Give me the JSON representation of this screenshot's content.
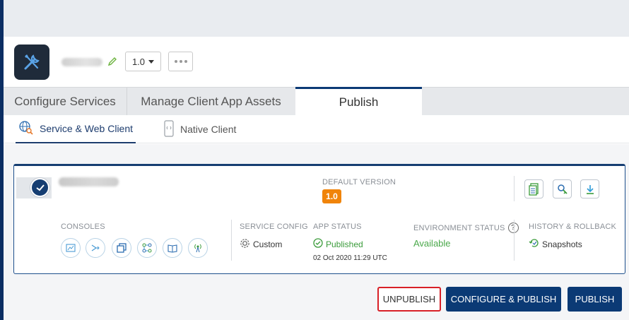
{
  "app": {
    "version": "1.0",
    "icon": "tools-icon"
  },
  "tabs": [
    {
      "label": "Configure Services"
    },
    {
      "label": "Manage Client App Assets"
    },
    {
      "label": "Publish",
      "active": true
    }
  ],
  "subtabs": [
    {
      "label": "Service & Web Client",
      "icon": "globe-search-icon",
      "active": true
    },
    {
      "label": "Native Client",
      "icon": "mobile-icon"
    }
  ],
  "card": {
    "default_version_label": "DEFAULT VERSION",
    "default_version": "1.0",
    "consoles_label": "CONSOLES",
    "consoles_icons": [
      "map-icon",
      "flow-icon",
      "copy-icon",
      "network-icon",
      "book-icon",
      "broadcast-icon"
    ],
    "service_config_label": "SERVICE CONFIG",
    "service_config_value": "Custom",
    "app_status_label": "APP STATUS",
    "app_status_value": "Published",
    "app_status_time": "02 Oct 2020 11:29 UTC",
    "environment_status_label": "ENVIRONMENT STATUS",
    "environment_status_value": "Available",
    "history_label": "HISTORY & ROLLBACK",
    "history_value": "Snapshots",
    "action_icons": [
      "document-icon",
      "key-icon",
      "download-icon"
    ]
  },
  "buttons": {
    "unpublish": "UNPUBLISH",
    "configure_publish": "CONFIGURE & PUBLISH",
    "publish": "PUBLISH"
  },
  "colors": {
    "primary": "#0b3a75",
    "version_badge": "#f0840a",
    "status_green": "#3a9b3a",
    "highlight_red": "#d82027"
  }
}
